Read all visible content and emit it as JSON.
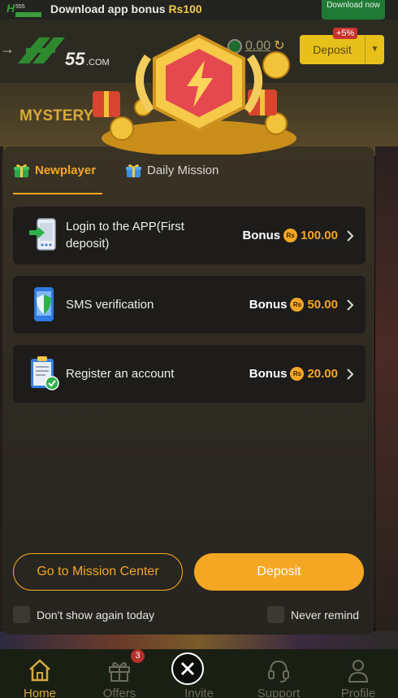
{
  "promo": {
    "text": "Download app bonus ",
    "amount": "Rs100",
    "button": "Download now"
  },
  "header": {
    "balance": "0.00",
    "deposit_label": "Deposit",
    "deposit_badge": "+5%"
  },
  "banner": {
    "text": "MYSTERY"
  },
  "modal": {
    "tabs": [
      {
        "label": "Newplayer",
        "active": true
      },
      {
        "label": "Daily Mission",
        "active": false
      }
    ],
    "tasks": [
      {
        "label": "Login to the APP(First deposit)",
        "bonus_word": "Bonus",
        "currency": "Rs",
        "amount": "100.00",
        "icon": "phone-login-icon"
      },
      {
        "label": "SMS verification",
        "bonus_word": "Bonus",
        "currency": "Rs",
        "amount": "50.00",
        "icon": "phone-shield-icon"
      },
      {
        "label": "Register an account",
        "bonus_word": "Bonus",
        "currency": "Rs",
        "amount": "20.00",
        "icon": "clipboard-check-icon"
      }
    ],
    "mission_center_button": "Go to Mission Center",
    "deposit_button": "Deposit",
    "dont_show_today": "Don't show again today",
    "never_remind": "Never remind"
  },
  "nav": {
    "items": [
      {
        "label": "Home",
        "icon": "home-icon",
        "active": true
      },
      {
        "label": "Offers",
        "icon": "gift-icon",
        "badge": "3"
      },
      {
        "label": "Invite",
        "icon": "invite-icon"
      },
      {
        "label": "Support",
        "icon": "headset-icon"
      },
      {
        "label": "Profile",
        "icon": "person-icon"
      }
    ]
  },
  "colors": {
    "accent": "#f5a623",
    "modal_bg": "#2f2b22",
    "card_bg": "#1d1c1a",
    "nav_bg": "#1a1f14"
  }
}
